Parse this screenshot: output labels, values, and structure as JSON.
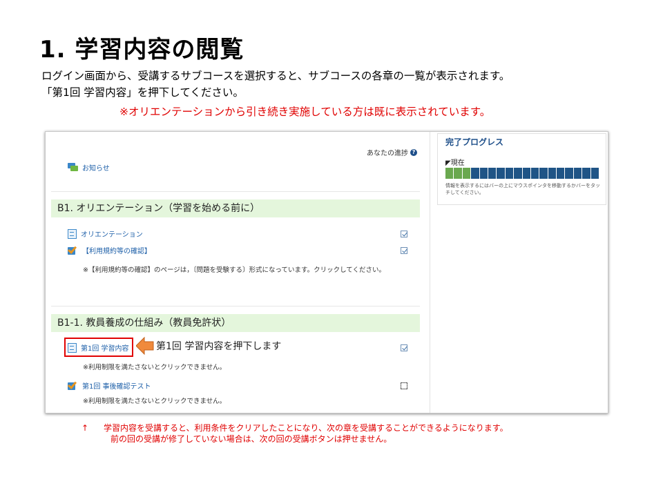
{
  "slide": {
    "title": "1.  学習内容の閲覧",
    "intro_line1": "ログイン画面から、受講するサブコースを選択すると、サブコースの各章の一覧が表示されます。",
    "intro_line2": "「第1回  学習内容」を押下してください。",
    "notice": "※オリエンテーションから引き続き実施している方は既に表示されています。",
    "callout": "第1回 学習内容を押下します",
    "footnote_arrow": "↑",
    "footnote_line1": "学習内容を受講すると、利用条件をクリアしたことになり、次の章を受講することができるようになります。",
    "footnote_line2": "前の回の受講が修了していない場合は、次の回の受講ボタンは押せません。"
  },
  "course": {
    "progress_label": "あなたの進捗",
    "news_label": "お知らせ",
    "section1": {
      "title": "B1. オリエンテーション（学習を始める前に）",
      "items": [
        {
          "label": "オリエンテーション",
          "status": "done"
        },
        {
          "label": "【利用規約等の確認】",
          "status": "done"
        }
      ],
      "note": "※【利用規約等の確認】のページは，〔問題を受験する〕形式になっています。クリックしてください。"
    },
    "section2": {
      "title": "B1-1.  教員養成の仕組み（教員免許状）",
      "items": [
        {
          "label": "第1回 学習内容",
          "status": "done",
          "restriction": "※利用制限を満たさないとクリックできません。"
        },
        {
          "label": "第1回 事後確認テスト",
          "status": "empty",
          "restriction": "※利用制限を満たさないとクリックできません。"
        }
      ]
    }
  },
  "sidebar": {
    "title": "完了プログレス",
    "now_label": "◤現在",
    "help": "情報を表示するにはバーの上にマウスポインタを移動するかバーをタッチしてください。",
    "progress": {
      "completed": 3,
      "total": 18
    },
    "colors": {
      "completed": "#6aa84f",
      "remaining": "#1f5486"
    }
  },
  "colors": {
    "accent_red": "#e00000",
    "section_bg": "#e4f6dc",
    "link": "#1d5fa8"
  }
}
